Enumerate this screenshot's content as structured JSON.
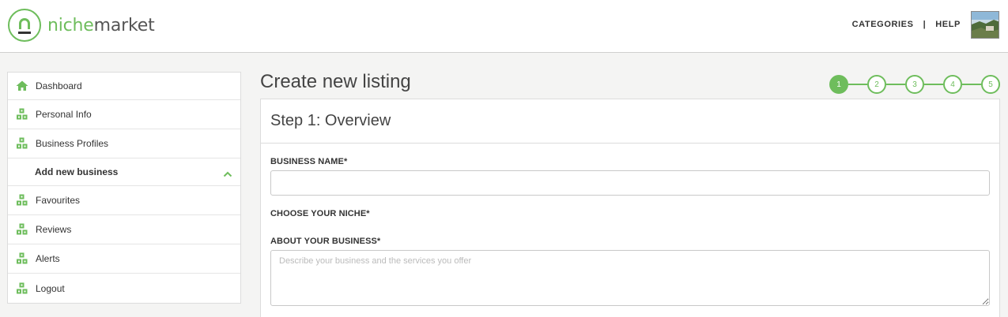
{
  "brand": {
    "part1": "niche",
    "part2": "market",
    "color": "#6ebd5c"
  },
  "topnav": {
    "categories": "CATEGORIES",
    "separator": "|",
    "help": "HELP"
  },
  "sidebar": {
    "items": [
      {
        "label": "Dashboard",
        "icon": "home-icon"
      },
      {
        "label": "Personal Info",
        "icon": "blocks-icon"
      },
      {
        "label": "Business Profiles",
        "icon": "blocks-icon"
      },
      {
        "label": "Add new business",
        "icon": "chevron-up-icon"
      },
      {
        "label": "Favourites",
        "icon": "blocks-icon"
      },
      {
        "label": "Reviews",
        "icon": "blocks-icon"
      },
      {
        "label": "Alerts",
        "icon": "blocks-icon"
      },
      {
        "label": "Logout",
        "icon": "blocks-icon"
      }
    ]
  },
  "page": {
    "title": "Create new listing"
  },
  "steps": [
    "1",
    "2",
    "3",
    "4",
    "5"
  ],
  "form": {
    "heading": "Step 1: Overview",
    "business_name_label": "BUSINESS NAME*",
    "business_name_value": "",
    "niche_label": "CHOOSE YOUR NICHE*",
    "about_label": "ABOUT YOUR BUSINESS*",
    "about_placeholder": "Describe your business and the services you offer"
  }
}
